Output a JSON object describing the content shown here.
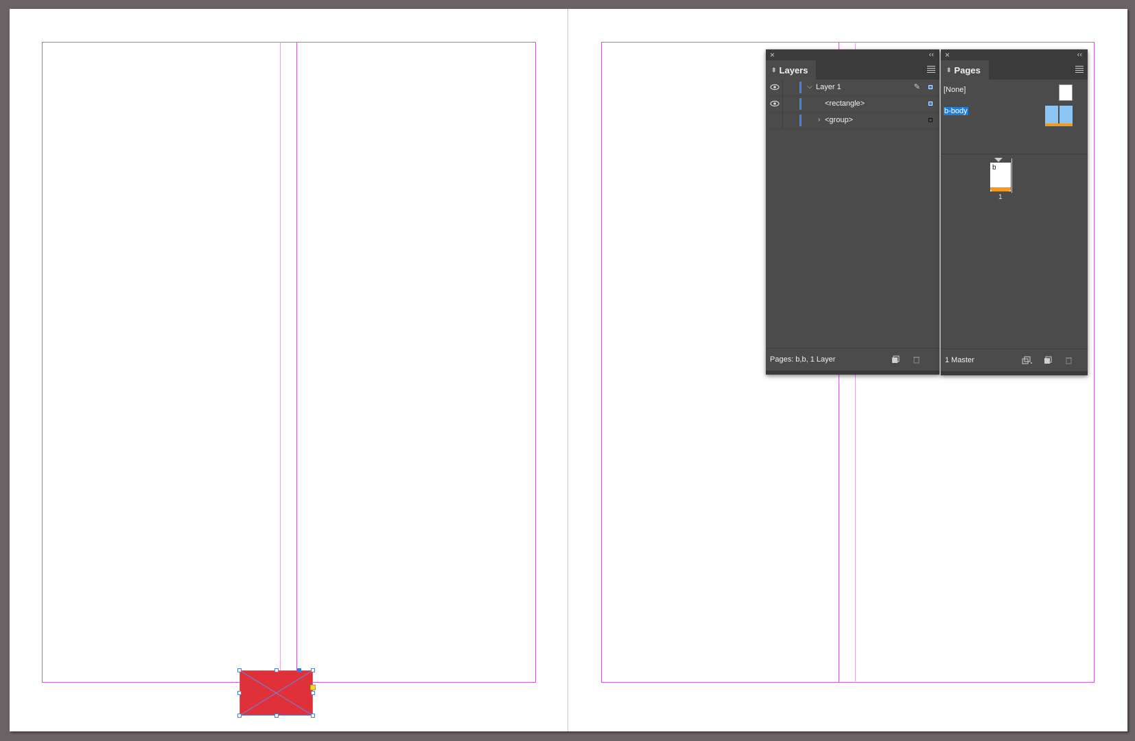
{
  "app": "Adobe InDesign",
  "colors": {
    "pasteboard": "#6b6266",
    "page": "#ffffff",
    "margin_guide": "#cc5ad2",
    "selected_frame_fill": "#e0313b",
    "selection_accent": "#2f7de1",
    "panel_bg": "#4b4b4b",
    "highlight": "#1f7fd6"
  },
  "layers_panel": {
    "tab_label": "Layers",
    "collapse_glyph": "‹‹",
    "close_glyph": "×",
    "rows": [
      {
        "label": "Layer 1",
        "visible": true,
        "expanded": true,
        "editable_icon": "pen-icon"
      },
      {
        "label": "<rectangle>",
        "visible": true
      },
      {
        "label": "<group>",
        "visible": false,
        "expanded": false
      }
    ],
    "footer_text": "Pages: b,b, 1 Layer"
  },
  "pages_panel": {
    "tab_label": "Pages",
    "collapse_glyph": "‹‹",
    "close_glyph": "×",
    "masters": [
      {
        "label": "[None]"
      },
      {
        "label": "b-body",
        "selected": true
      }
    ],
    "page_thumb_prefix": "b",
    "page_number": "1",
    "footer_text": "1 Master"
  }
}
